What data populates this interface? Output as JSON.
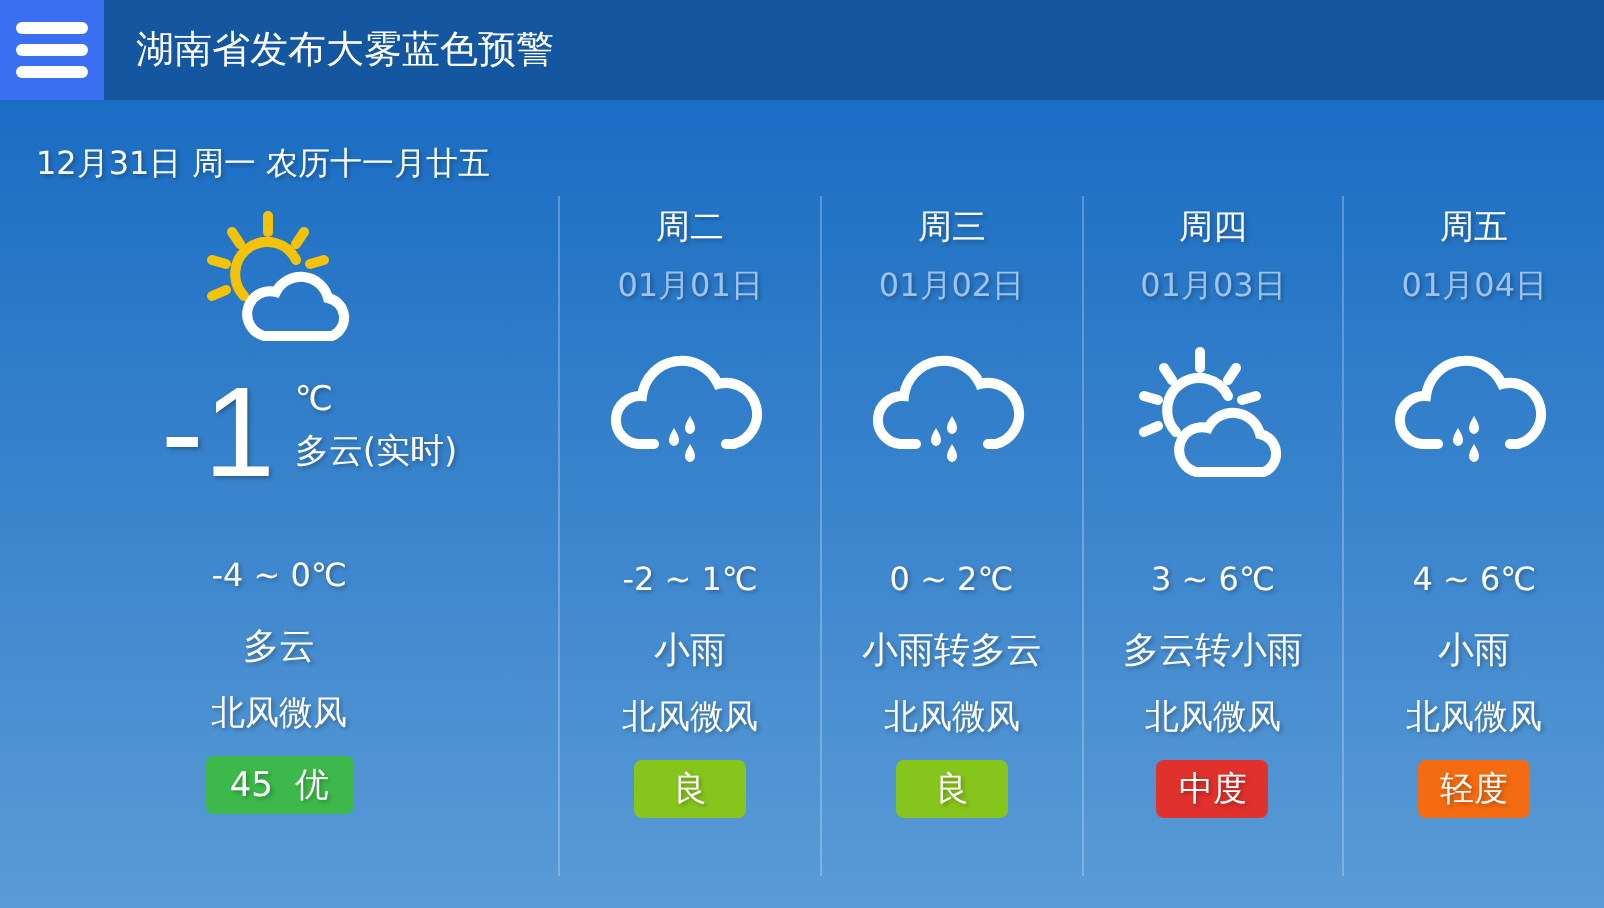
{
  "header": {
    "title": "湖南省发布大雾蓝色预警"
  },
  "date_line": "12月31日 周一 农历十一月廿五",
  "today": {
    "kind": "partly-cloudy",
    "temperature": "-1",
    "unit": "℃",
    "condition": "多云(实时)",
    "range": "-4 ~ 0℃",
    "weather": "多云",
    "wind": "北风微风",
    "aqi": {
      "label": "45  优",
      "color": "#3cb94a"
    }
  },
  "forecast": [
    {
      "day": "周二",
      "date": "01月01日",
      "kind": "rain",
      "range": "-2 ~ 1℃",
      "weather": "小雨",
      "wind": "北风微风",
      "aqi": {
        "label": "良",
        "color": "#86c51c"
      }
    },
    {
      "day": "周三",
      "date": "01月02日",
      "kind": "rain",
      "range": "0 ~ 2℃",
      "weather": "小雨转多云",
      "wind": "北风微风",
      "aqi": {
        "label": "良",
        "color": "#86c51c"
      }
    },
    {
      "day": "周四",
      "date": "01月03日",
      "kind": "partly-cloudy",
      "range": "3 ~ 6℃",
      "weather": "多云转小雨",
      "wind": "北风微风",
      "aqi": {
        "label": "中度",
        "color": "#e0312c"
      }
    },
    {
      "day": "周五",
      "date": "01月04日",
      "kind": "rain",
      "range": "4 ~ 6℃",
      "weather": "小雨",
      "wind": "北风微风",
      "aqi": {
        "label": "轻度",
        "color": "#f56b11"
      }
    }
  ]
}
